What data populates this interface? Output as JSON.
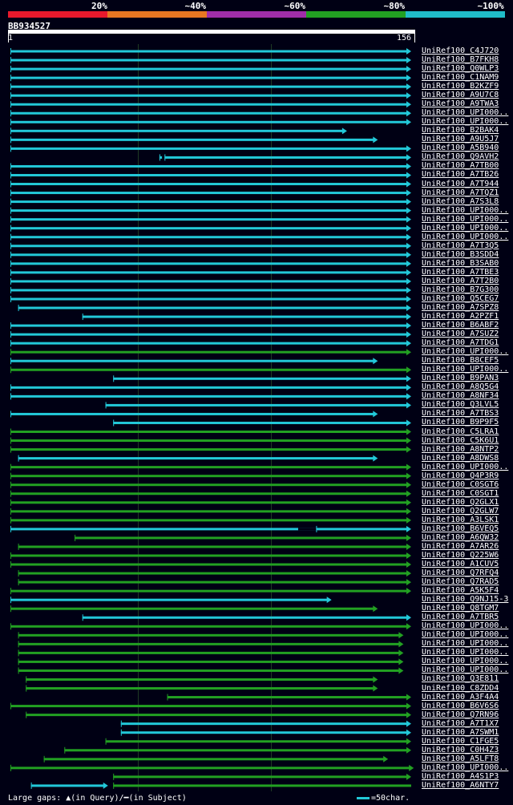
{
  "legend": {
    "labels": [
      "20%",
      "~40%",
      "~60%",
      "~80%",
      "~100%"
    ],
    "colors": [
      "#e8192c",
      "#e87722",
      "#a02ea8",
      "#22a022",
      "#20bcc8"
    ]
  },
  "query": {
    "name": "BB934527",
    "start": "1",
    "end": "156"
  },
  "hits": [
    {
      "name": "UniRef100_C4J720",
      "s": 0,
      "e": 156,
      "c": "cyan",
      "gap": null
    },
    {
      "name": "UniRef100_B7FKH8",
      "s": 0,
      "e": 156,
      "c": "cyan",
      "gap": null
    },
    {
      "name": "UniRef100_Q0WLP3",
      "s": 0,
      "e": 156,
      "c": "cyan",
      "gap": null
    },
    {
      "name": "UniRef100_C1NAM9",
      "s": 0,
      "e": 156,
      "c": "cyan",
      "gap": null
    },
    {
      "name": "UniRef100_B2KZF9",
      "s": 0,
      "e": 156,
      "c": "cyan",
      "gap": null
    },
    {
      "name": "UniRef100_A9U7C8",
      "s": 0,
      "e": 156,
      "c": "cyan",
      "gap": null
    },
    {
      "name": "UniRef100_A9TWA3",
      "s": 0,
      "e": 156,
      "c": "cyan",
      "gap": null
    },
    {
      "name": "UniRef100_UPI000..",
      "s": 0,
      "e": 156,
      "c": "cyan",
      "gap": null
    },
    {
      "name": "UniRef100_UPI000..",
      "s": 0,
      "e": 156,
      "c": "cyan",
      "gap": null
    },
    {
      "name": "UniRef100_B2BAK4",
      "s": 0,
      "e": 131,
      "c": "cyan",
      "gap": null
    },
    {
      "name": "UniRef100_A9U5J7",
      "s": 0,
      "e": 143,
      "c": "cyan",
      "gap": null
    },
    {
      "name": "UniRef100_A5B940",
      "s": 0,
      "e": 156,
      "c": "cyan",
      "gap": null
    },
    {
      "name": "UniRef100_Q9AVH2",
      "s": 58,
      "e": 156,
      "c": "cyan",
      "gap": [
        59,
        60
      ]
    },
    {
      "name": "UniRef100_A7TB00",
      "s": 0,
      "e": 156,
      "c": "cyan",
      "gap": null
    },
    {
      "name": "UniRef100_A7TB26",
      "s": 0,
      "e": 156,
      "c": "cyan",
      "gap": null
    },
    {
      "name": "UniRef100_A7T944",
      "s": 0,
      "e": 156,
      "c": "cyan",
      "gap": null
    },
    {
      "name": "UniRef100_A7TQZ1",
      "s": 0,
      "e": 156,
      "c": "cyan",
      "gap": null
    },
    {
      "name": "UniRef100_A7S3L8",
      "s": 0,
      "e": 156,
      "c": "cyan",
      "gap": null
    },
    {
      "name": "UniRef100_UPI000..",
      "s": 0,
      "e": 156,
      "c": "cyan",
      "gap": null
    },
    {
      "name": "UniRef100_UPI000..",
      "s": 0,
      "e": 156,
      "c": "cyan",
      "gap": null
    },
    {
      "name": "UniRef100_UPI000..",
      "s": 0,
      "e": 156,
      "c": "cyan",
      "gap": null
    },
    {
      "name": "UniRef100_UPI000..",
      "s": 0,
      "e": 156,
      "c": "cyan",
      "gap": null
    },
    {
      "name": "UniRef100_A7T3Q5",
      "s": 0,
      "e": 156,
      "c": "cyan",
      "gap": null
    },
    {
      "name": "UniRef100_B3SDD4",
      "s": 0,
      "e": 156,
      "c": "cyan",
      "gap": null
    },
    {
      "name": "UniRef100_B3SAB0",
      "s": 0,
      "e": 156,
      "c": "cyan",
      "gap": null
    },
    {
      "name": "UniRef100_A7TBE3",
      "s": 0,
      "e": 156,
      "c": "cyan",
      "gap": null
    },
    {
      "name": "UniRef100_A7T2B0",
      "s": 0,
      "e": 156,
      "c": "cyan",
      "gap": null
    },
    {
      "name": "UniRef100_B7G300",
      "s": 0,
      "e": 156,
      "c": "cyan",
      "gap": null
    },
    {
      "name": "UniRef100_Q5CEG7",
      "s": 0,
      "e": 156,
      "c": "cyan",
      "gap": null
    },
    {
      "name": "UniRef100_A7SPZ8",
      "s": 3,
      "e": 156,
      "c": "cyan",
      "gap": null
    },
    {
      "name": "UniRef100_A2PZF1",
      "s": 28,
      "e": 156,
      "c": "cyan",
      "gap": null
    },
    {
      "name": "UniRef100_B6ABF2",
      "s": 0,
      "e": 156,
      "c": "cyan",
      "gap": null
    },
    {
      "name": "UniRef100_A7SUZ2",
      "s": 0,
      "e": 156,
      "c": "cyan",
      "gap": null
    },
    {
      "name": "UniRef100_A7TDG1",
      "s": 0,
      "e": 156,
      "c": "cyan",
      "gap": null
    },
    {
      "name": "UniRef100_UPI000..",
      "s": 0,
      "e": 156,
      "c": "green",
      "gap": null
    },
    {
      "name": "UniRef100_B8CEF5",
      "s": 0,
      "e": 143,
      "c": "cyan",
      "gap": null
    },
    {
      "name": "UniRef100_UPI000..",
      "s": 0,
      "e": 156,
      "c": "green",
      "gap": null
    },
    {
      "name": "UniRef100_B9PAN3",
      "s": 40,
      "e": 156,
      "c": "cyan",
      "gap": null
    },
    {
      "name": "UniRef100_A8Q5G4",
      "s": 0,
      "e": 156,
      "c": "cyan",
      "gap": null
    },
    {
      "name": "UniRef100_A8NF34",
      "s": 0,
      "e": 156,
      "c": "cyan",
      "gap": null
    },
    {
      "name": "UniRef100_Q3LVL5",
      "s": 37,
      "e": 156,
      "c": "cyan",
      "gap": null
    },
    {
      "name": "UniRef100_A7TBS3",
      "s": 0,
      "e": 143,
      "c": "cyan",
      "gap": null
    },
    {
      "name": "UniRef100_B9P9F5",
      "s": 40,
      "e": 156,
      "c": "cyan",
      "gap": null
    },
    {
      "name": "UniRef100_C5LRA1",
      "s": 0,
      "e": 156,
      "c": "green",
      "gap": null
    },
    {
      "name": "UniRef100_C5K6U1",
      "s": 0,
      "e": 156,
      "c": "green",
      "gap": null
    },
    {
      "name": "UniRef100_A8NTP2",
      "s": 0,
      "e": 156,
      "c": "green",
      "gap": null
    },
    {
      "name": "UniRef100_A8DWS8",
      "s": 3,
      "e": 143,
      "c": "cyan",
      "gap": null
    },
    {
      "name": "UniRef100_UPI000..",
      "s": 0,
      "e": 156,
      "c": "green",
      "gap": null
    },
    {
      "name": "UniRef100_Q4P3R9",
      "s": 0,
      "e": 156,
      "c": "green",
      "gap": null
    },
    {
      "name": "UniRef100_C0SGT6",
      "s": 0,
      "e": 156,
      "c": "green",
      "gap": null
    },
    {
      "name": "UniRef100_C0SGT1",
      "s": 0,
      "e": 156,
      "c": "green",
      "gap": null
    },
    {
      "name": "UniRef100_Q2GLX1",
      "s": 0,
      "e": 156,
      "c": "green",
      "gap": null
    },
    {
      "name": "UniRef100_Q2GLW7",
      "s": 0,
      "e": 156,
      "c": "green",
      "gap": null
    },
    {
      "name": "UniRef100_A3LSK1",
      "s": 0,
      "e": 156,
      "c": "green",
      "gap": null
    },
    {
      "name": "UniRef100_B6VEQ5",
      "s": 0,
      "e": 156,
      "c": "cyan",
      "gap": [
        112,
        119
      ]
    },
    {
      "name": "UniRef100_A6QW32",
      "s": 25,
      "e": 156,
      "c": "green",
      "gap": null
    },
    {
      "name": "UniRef100_A7AR26",
      "s": 3,
      "e": 156,
      "c": "green",
      "gap": null
    },
    {
      "name": "UniRef100_Q225W6",
      "s": 0,
      "e": 156,
      "c": "green",
      "gap": null
    },
    {
      "name": "UniRef100_A1CUV5",
      "s": 0,
      "e": 156,
      "c": "green",
      "gap": null
    },
    {
      "name": "UniRef100_Q7RFQ4",
      "s": 3,
      "e": 156,
      "c": "green",
      "gap": null
    },
    {
      "name": "UniRef100_Q7RAD5",
      "s": 3,
      "e": 156,
      "c": "green",
      "gap": null
    },
    {
      "name": "UniRef100_A5K5F4",
      "s": 0,
      "e": 156,
      "c": "green",
      "gap": null
    },
    {
      "name": "UniRef100_Q9NJ15-3",
      "s": 0,
      "e": 125,
      "c": "cyan",
      "gap": null
    },
    {
      "name": "UniRef100_Q8TGM7",
      "s": 0,
      "e": 143,
      "c": "green",
      "gap": null
    },
    {
      "name": "UniRef100_A7TBR5",
      "s": 28,
      "e": 156,
      "c": "cyan",
      "gap": null
    },
    {
      "name": "UniRef100_UPI000..",
      "s": 0,
      "e": 156,
      "c": "green",
      "gap": null
    },
    {
      "name": "UniRef100_UPI000..",
      "s": 3,
      "e": 153,
      "c": "green",
      "gap": null
    },
    {
      "name": "UniRef100_UPI000..",
      "s": 3,
      "e": 153,
      "c": "green",
      "gap": null
    },
    {
      "name": "UniRef100_UPI000..",
      "s": 3,
      "e": 153,
      "c": "green",
      "gap": null
    },
    {
      "name": "UniRef100_UPI000..",
      "s": 3,
      "e": 153,
      "c": "green",
      "gap": null
    },
    {
      "name": "UniRef100_UPI000..",
      "s": 3,
      "e": 153,
      "c": "green",
      "gap": null
    },
    {
      "name": "UniRef100_Q3E811",
      "s": 6,
      "e": 143,
      "c": "green",
      "gap": null
    },
    {
      "name": "UniRef100_C8ZDD4",
      "s": 6,
      "e": 143,
      "c": "green",
      "gap": null
    },
    {
      "name": "UniRef100_A3F4A4",
      "s": 61,
      "e": 156,
      "c": "green",
      "gap": null
    },
    {
      "name": "UniRef100_B6V6S6",
      "s": 0,
      "e": 156,
      "c": "green",
      "gap": null
    },
    {
      "name": "UniRef100_Q7RN96",
      "s": 6,
      "e": 156,
      "c": "green",
      "gap": null
    },
    {
      "name": "UniRef100_A7T1X7",
      "s": 43,
      "e": 156,
      "c": "cyan",
      "gap": null
    },
    {
      "name": "UniRef100_A7SWM1",
      "s": 43,
      "e": 156,
      "c": "cyan",
      "gap": null
    },
    {
      "name": "UniRef100_C1FGE5",
      "s": 37,
      "e": 156,
      "c": "green",
      "gap": null
    },
    {
      "name": "UniRef100_C0H4Z3",
      "s": 21,
      "e": 156,
      "c": "green",
      "gap": null
    },
    {
      "name": "UniRef100_A5LFT8",
      "s": 13,
      "e": 147,
      "c": "green",
      "gap": null
    },
    {
      "name": "UniRef100_UPI000..",
      "s": 0,
      "e": 157,
      "c": "green",
      "gap": null
    },
    {
      "name": "UniRef100_A4S1P3",
      "s": 40,
      "e": 156,
      "c": "green",
      "gap": null
    },
    {
      "name": "UniRef100_A6NTY7",
      "s": 8,
      "e": 38,
      "c": "cyan",
      "gap": null,
      "tail": [
        40,
        156
      ]
    }
  ],
  "footer": {
    "large_gaps": "Large gaps: ",
    "in_query": "(in Query)/",
    "in_subject": "(in Subject)",
    "scale": "=50char."
  },
  "colors": {
    "cyan": "#22c8d8",
    "green": "#22a022",
    "grid": "#1f3a24"
  }
}
